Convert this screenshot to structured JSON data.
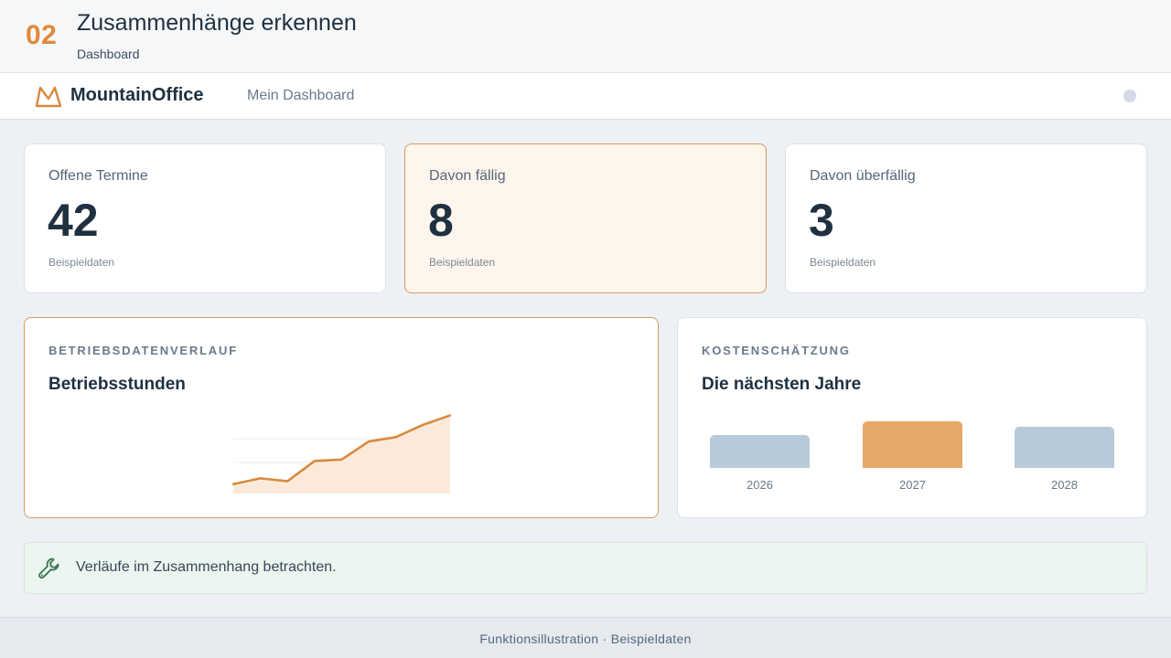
{
  "header": {
    "step": "02",
    "title": "Zusammenhänge erkennen",
    "subtitle": "Dashboard"
  },
  "app_bar": {
    "brand": "MountainOffice",
    "nav_link": "Mein Dashboard",
    "logo_icon": "mountain-logo-icon",
    "avatar_icon": "avatar-icon"
  },
  "kpis": [
    {
      "label": "Offene Termine",
      "value": "42",
      "note": "Beispieldaten"
    },
    {
      "label": "Davon fällig",
      "value": "8",
      "note": "Beispieldaten"
    },
    {
      "label": "Davon überfällig",
      "value": "3",
      "note": "Beispieldaten"
    }
  ],
  "line_card": {
    "eyebrow": "BETRIEBSDATENVERLAUF",
    "title": "Betriebsstunden"
  },
  "bar_card": {
    "eyebrow": "KOSTENSCHÄTZUNG",
    "title": "Die nächsten Jahre"
  },
  "chart_data": [
    {
      "type": "area",
      "title": "Betriebsstunden",
      "x": [
        1,
        2,
        3,
        4,
        5,
        6,
        7,
        8,
        9
      ],
      "values": [
        13,
        21,
        17,
        45,
        47,
        72,
        78,
        95,
        108
      ],
      "ylim": [
        0,
        110
      ],
      "grid": true,
      "colors": {
        "line": "#d9893f",
        "fill": "#fbeadb",
        "grid": "#e9ecef"
      }
    },
    {
      "type": "bar",
      "title": "Die nächsten Jahre",
      "categories": [
        "2026",
        "2027",
        "2028"
      ],
      "values": [
        36,
        51,
        45
      ],
      "highlight": "2027",
      "colors": {
        "base": "#b8cad8",
        "highlight": "#e8a867"
      }
    }
  ],
  "tip": {
    "icon": "wrench-icon",
    "text": "Verläufe im Zusammenhang betrachten."
  },
  "footer": {
    "text": "Funktionsillustration · Beispieldaten"
  },
  "colors": {
    "accent": "#e08a3c",
    "success_bg": "#ecf5ef",
    "warm_bg": "#fef5ec"
  }
}
